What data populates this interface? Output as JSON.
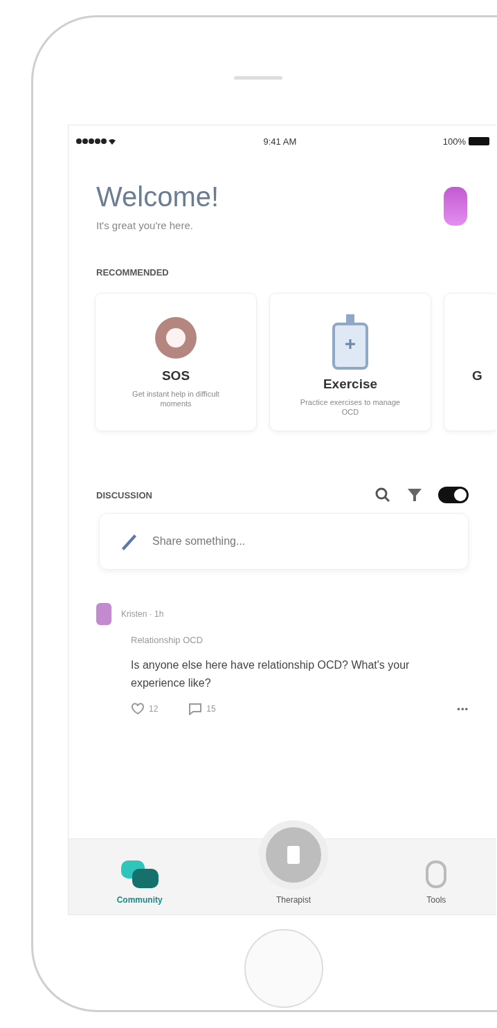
{
  "status_bar": {
    "time": "9:41 AM",
    "battery": "100%"
  },
  "header": {
    "title": "Welcome!",
    "subtitle": "It's great you're here."
  },
  "recommended": {
    "heading": "RECOMMENDED",
    "cards": [
      {
        "kind": "sos",
        "title": "SOS",
        "description": "Get instant help in difficult moments"
      },
      {
        "kind": "exercise",
        "title": "Exercise",
        "description": "Practice exercises to manage OCD"
      },
      {
        "kind": "partial",
        "title": "G"
      }
    ]
  },
  "discussion": {
    "heading": "DISCUSSION",
    "toggle": {
      "on": true
    },
    "composer": {
      "placeholder": "Share something..."
    },
    "posts": [
      {
        "author": "Kristen · 1h",
        "topic": "Relationship OCD",
        "text": "Is anyone else here have relationship OCD? What's your experience like?",
        "likes": "12",
        "comments": "15",
        "more": "•••"
      }
    ]
  },
  "nav": [
    {
      "kind": "community",
      "label": "Community",
      "selected": true
    },
    {
      "kind": "therapist",
      "label": "Therapist",
      "selected": false
    },
    {
      "kind": "tools",
      "label": "Tools",
      "selected": false
    }
  ]
}
